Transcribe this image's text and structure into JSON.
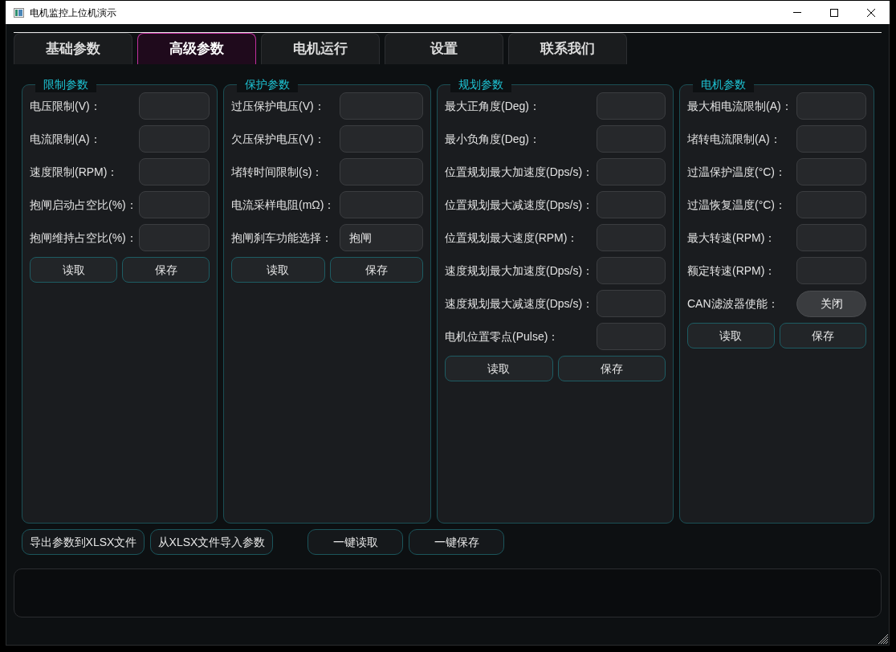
{
  "window": {
    "title": "电机监控上位机演示"
  },
  "tabs": [
    {
      "label": "基础参数",
      "selected": false
    },
    {
      "label": "高级参数",
      "selected": true
    },
    {
      "label": "电机运行",
      "selected": false
    },
    {
      "label": "设置",
      "selected": false
    },
    {
      "label": "联系我们",
      "selected": false
    }
  ],
  "groups": [
    {
      "title": "限制参数",
      "fields": [
        {
          "kind": "input",
          "label": "电压限制(V)："
        },
        {
          "kind": "input",
          "label": "电流限制(A)："
        },
        {
          "kind": "input",
          "label": "速度限制(RPM)："
        },
        {
          "kind": "input",
          "label": "抱闸启动占空比(%)："
        },
        {
          "kind": "input",
          "label": "抱闸维持占空比(%)："
        }
      ],
      "buttons": [
        "读取",
        "保存"
      ]
    },
    {
      "title": "保护参数",
      "fields": [
        {
          "kind": "input",
          "label": "过压保护电压(V)："
        },
        {
          "kind": "input",
          "label": "欠压保护电压(V)："
        },
        {
          "kind": "input",
          "label": "堵转时间限制(s)："
        },
        {
          "kind": "input",
          "label": "电流采样电阻(mΩ)："
        },
        {
          "kind": "select",
          "label": "抱闸刹车功能选择：",
          "value": "抱闸"
        }
      ],
      "buttons": [
        "读取",
        "保存"
      ]
    },
    {
      "title": "规划参数",
      "fields": [
        {
          "kind": "input",
          "label": "最大正角度(Deg)："
        },
        {
          "kind": "input",
          "label": "最小负角度(Deg)："
        },
        {
          "kind": "input",
          "label": "位置规划最大加速度(Dps/s)："
        },
        {
          "kind": "input",
          "label": "位置规划最大减速度(Dps/s)："
        },
        {
          "kind": "input",
          "label": "位置规划最大速度(RPM)："
        },
        {
          "kind": "input",
          "label": "速度规划最大加速度(Dps/s)："
        },
        {
          "kind": "input",
          "label": "速度规划最大减速度(Dps/s)："
        },
        {
          "kind": "input",
          "label": "电机位置零点(Pulse)："
        }
      ],
      "buttons": [
        "读取",
        "保存"
      ]
    },
    {
      "title": "电机参数",
      "fields": [
        {
          "kind": "input",
          "label": "最大相电流限制(A)："
        },
        {
          "kind": "input",
          "label": "堵转电流限制(A)："
        },
        {
          "kind": "input",
          "label": "过温保护温度(°C)："
        },
        {
          "kind": "input",
          "label": "过温恢复温度(°C)："
        },
        {
          "kind": "input",
          "label": "最大转速(RPM)："
        },
        {
          "kind": "input",
          "label": "额定转速(RPM)："
        },
        {
          "kind": "toggle",
          "label": "CAN滤波器使能：",
          "value": "关闭"
        }
      ],
      "buttons": [
        "读取",
        "保存"
      ]
    }
  ],
  "actions": [
    "导出参数到XLSX文件",
    "从XLSX文件导入参数",
    "一键读取",
    "一键保存"
  ]
}
